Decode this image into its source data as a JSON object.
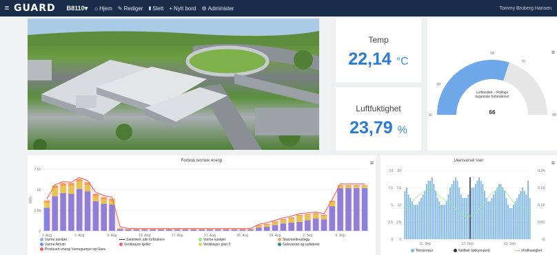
{
  "topbar": {
    "logo": "GUARD",
    "building": "B8110▾",
    "nav": [
      {
        "icon": "home-icon",
        "glyph": "⌂",
        "label": "Hjem"
      },
      {
        "icon": "pencil-icon",
        "glyph": "✎",
        "label": "Rediger"
      },
      {
        "icon": "trash-icon",
        "glyph": "🗑",
        "label": "Slett"
      },
      {
        "icon": "plus-icon",
        "glyph": "+",
        "label": "Nytt bord"
      },
      {
        "icon": "gear-icon",
        "glyph": "⚙",
        "label": "Administer"
      }
    ],
    "user": "Tommy Bruberg Hansen"
  },
  "temp": {
    "title": "Temp",
    "value": "22,14",
    "unit": "°C"
  },
  "humidity": {
    "title": "Luftfuktighet",
    "value": "23,79",
    "unit": "%"
  },
  "gauge": {
    "label_line1": "Luftkvalitet – Flyktige",
    "label_line2": "organiske forbindelser",
    "value": 66,
    "min": 30,
    "max": 90,
    "ticks": [
      "30",
      "40",
      "60",
      "70",
      "90"
    ],
    "fill_color": "#6fa8e8",
    "track_color": "#e6e6e6"
  },
  "energy_chart": {
    "title": "Forbruk termisk energi",
    "yticks": [
      "7,5k",
      "5k",
      "2,5k",
      "0"
    ],
    "ylabel": "kWh",
    "xticks": [
      "1. Aug",
      "5. Aug",
      "9. Aug",
      "13. Aug",
      "17. Aug",
      "21. Aug",
      "25. Aug",
      "29. Aug",
      "2. Sep",
      "6. Sep"
    ],
    "legend": [
      {
        "type": "dot",
        "color": "#7cb5ec",
        "label": "Varme sanitær"
      },
      {
        "type": "line",
        "color": "#333333",
        "label": "Sammenl. alle forbrukere"
      },
      {
        "type": "dot",
        "color": "#90ed7d",
        "label": "Varme sanitær"
      },
      {
        "type": "dot",
        "color": "#f7a35c",
        "label": "Snøsmelteanlegg"
      },
      {
        "type": "dot",
        "color": "#8085e9",
        "label": "Varme Atrium"
      },
      {
        "type": "dot",
        "color": "#f15c80",
        "label": "Ventilasjon kjeller"
      },
      {
        "type": "dot",
        "color": "#e4d354",
        "label": "Ventilasjon plan 2"
      },
      {
        "type": "dot",
        "color": "#2b908f",
        "label": "Gulvvarme og radiatorer"
      },
      {
        "type": "dot",
        "color": "#f45b5b",
        "label": "Produsert energi Varmepumpe og Gass"
      }
    ]
  },
  "weather_chart": {
    "title": "Ukesvarsel Vær",
    "yleft": [
      "20",
      "7,5",
      "12",
      "2,5",
      "0"
    ],
    "yleft_outer": [
      "10",
      "7,5",
      "5",
      "2,5",
      "0"
    ],
    "yright": [
      "0,24",
      "0,18",
      "0,12",
      "0,06",
      "0"
    ],
    "xticks": [
      "11. Sep",
      "12. Sep",
      "13. Sep"
    ],
    "legend": [
      {
        "type": "dot",
        "color": "#7cb5ec",
        "label": "Temperatur"
      },
      {
        "type": "dot",
        "color": "#333333",
        "label": "Nedbør (akkumulert)"
      },
      {
        "type": "line",
        "color": "#90ed7d",
        "label": "Vindhastighet"
      }
    ]
  },
  "chart_data": [
    {
      "type": "bar",
      "title": "Forbruk termisk energi",
      "ylabel": "kWh",
      "ylim": [
        0,
        7500
      ],
      "categories": [
        "1. Aug",
        "2. Aug",
        "3. Aug",
        "4. Aug",
        "5. Aug",
        "6. Aug",
        "7. Aug",
        "8. Aug",
        "9. Aug",
        "10. Aug",
        "11. Aug",
        "12. Aug",
        "13. Aug",
        "14. Aug",
        "15. Aug",
        "16. Aug",
        "17. Aug",
        "18. Aug",
        "19. Aug",
        "20. Aug",
        "21. Aug",
        "22. Aug",
        "23. Aug",
        "24. Aug",
        "25. Aug",
        "26. Aug",
        "27. Aug",
        "28. Aug",
        "29. Aug",
        "30. Aug",
        "31. Aug",
        "1. Sep",
        "2. Sep",
        "3. Sep",
        "4. Sep",
        "5. Sep",
        "6. Sep",
        "7. Sep",
        "8. Sep",
        "9. Sep"
      ],
      "series": [
        {
          "name": "Varme Atrium",
          "color": "#8085e9",
          "values": [
            2800,
            4200,
            4600,
            4500,
            5100,
            4800,
            3600,
            3300,
            3200,
            200,
            150,
            150,
            150,
            150,
            150,
            150,
            150,
            150,
            150,
            150,
            150,
            150,
            150,
            150,
            150,
            150,
            400,
            500,
            700,
            900,
            1000,
            1100,
            1300,
            1500,
            1400,
            3000,
            5200,
            5200,
            5200,
            5200
          ]
        },
        {
          "name": "Ventilasjon plan 2",
          "color": "#e4d354",
          "values": [
            600,
            1000,
            900,
            1000,
            900,
            800,
            600,
            500,
            400,
            0,
            0,
            0,
            0,
            0,
            0,
            0,
            0,
            0,
            0,
            0,
            0,
            0,
            0,
            0,
            0,
            0,
            150,
            200,
            300,
            400,
            500,
            700,
            600,
            500,
            400,
            500,
            200,
            200,
            200,
            200
          ]
        },
        {
          "name": "Varme sanitær",
          "color": "#f7a35c",
          "values": [
            300,
            300,
            300,
            300,
            300,
            300,
            300,
            300,
            300,
            100,
            100,
            100,
            100,
            100,
            100,
            100,
            100,
            100,
            100,
            100,
            100,
            100,
            100,
            100,
            100,
            100,
            150,
            150,
            150,
            150,
            150,
            150,
            150,
            150,
            150,
            150,
            150,
            150,
            150,
            150
          ]
        },
        {
          "name": "Produsert energi Varmepumpe og Gass",
          "color": "#f45b5b",
          "values": [
            3900,
            5600,
            6000,
            5900,
            6500,
            6100,
            4700,
            4300,
            4100,
            500,
            300,
            300,
            300,
            300,
            300,
            300,
            300,
            300,
            300,
            300,
            300,
            300,
            300,
            300,
            300,
            300,
            800,
            1000,
            1300,
            1600,
            1800,
            2100,
            2200,
            2300,
            2100,
            3800,
            5700,
            5700,
            5700,
            5700
          ]
        }
      ]
    },
    {
      "type": "bar",
      "title": "Ukesvarsel Vær",
      "categories": [
        "11. Sep",
        "12. Sep",
        "13. Sep"
      ],
      "ylim": [
        0,
        20
      ],
      "y2lim": [
        0,
        0.24
      ],
      "series": [
        {
          "name": "Temperatur",
          "color": "#7cb5ec",
          "values": [
            14,
            15,
            13,
            12,
            11,
            10,
            10,
            10,
            11,
            12,
            13,
            14,
            16,
            17,
            17,
            18,
            16,
            14,
            12,
            11,
            10,
            10,
            10,
            11,
            13,
            15,
            16,
            17,
            18,
            17,
            15,
            13,
            12,
            12,
            12,
            13,
            14,
            15,
            15,
            16,
            17,
            18,
            17,
            16,
            14,
            12,
            11,
            11,
            12,
            13,
            14,
            15,
            16,
            16,
            15,
            14,
            12,
            10,
            9,
            9,
            10,
            11,
            12,
            13,
            14,
            15,
            14,
            13,
            17,
            12
          ]
        },
        {
          "name": "Nedbør (akkumulert)",
          "color": "#333333",
          "values": [
            0,
            0,
            0,
            0,
            0,
            0,
            0,
            0,
            0,
            0,
            0,
            0,
            0,
            0,
            0,
            0,
            0,
            0,
            0,
            0,
            0,
            0,
            0,
            0,
            0,
            0,
            0,
            0,
            0,
            0,
            0,
            0,
            0,
            0,
            0,
            0,
            18,
            0,
            0,
            0,
            0,
            0,
            0,
            0,
            0,
            0,
            0,
            0,
            0,
            0,
            0,
            0,
            0,
            0,
            0,
            0,
            0,
            0,
            0,
            0,
            0,
            0,
            0,
            0,
            0,
            0,
            0,
            0,
            0,
            0
          ]
        },
        {
          "name": "Vindhastighet",
          "color": "#90ed7d",
          "values": [
            0.1,
            0.12,
            0.13,
            0.15,
            0.16,
            0.17,
            0.18,
            0.17,
            0.15,
            0.14,
            0.13,
            0.12,
            0.1,
            0.09,
            0.08,
            0.08,
            0.09,
            0.1,
            0.12,
            0.14,
            0.16,
            0.17,
            0.18,
            0.17,
            0.15,
            0.13,
            0.12,
            0.11,
            0.1,
            0.1
          ]
        }
      ]
    }
  ]
}
